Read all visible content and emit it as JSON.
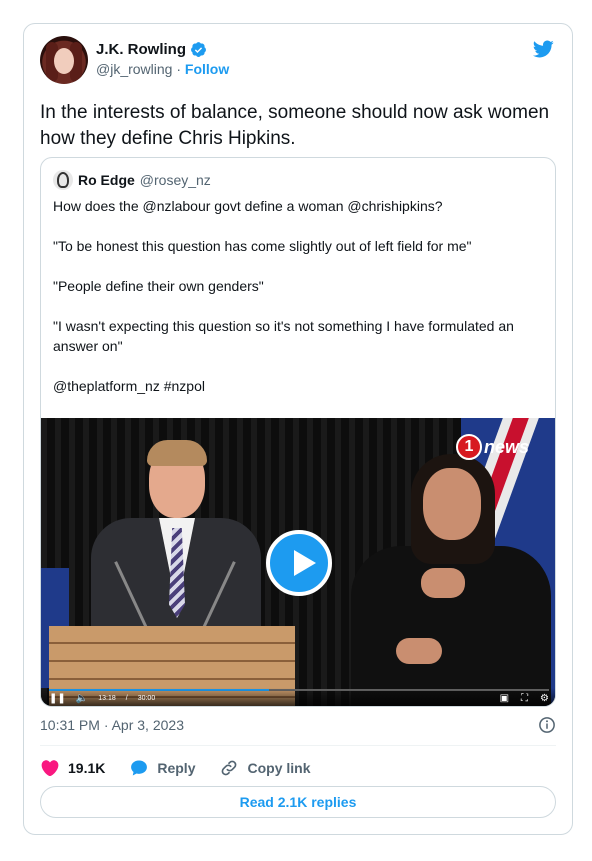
{
  "author": {
    "name": "J.K. Rowling",
    "handle": "@jk_rowling",
    "separator": "·",
    "follow_label": "Follow"
  },
  "tweet": {
    "text": "In the interests of balance, someone should now ask women how they define Chris Hipkins.",
    "timestamp": "10:31 PM · Apr 3, 2023"
  },
  "quoted": {
    "name": "Ro Edge",
    "handle": "@rosey_nz",
    "lines": [
      "How does the @nzlabour govt define a woman @chrishipkins?",
      "\"To be honest this question has come slightly out of left field for me\"",
      "\"People define their own genders\"",
      "\"I wasn't expecting this question so it's not something I have formulated an answer on\"",
      "@theplatform_nz #nzpol"
    ]
  },
  "video": {
    "brand_number": "1",
    "brand_text": "news",
    "current_time": "13:18",
    "time_sep": "/",
    "duration": "30:00",
    "progress": 0.44
  },
  "actions": {
    "likes": "19.1K",
    "reply_label": "Reply",
    "copy_label": "Copy link",
    "read_replies": "Read 2.1K replies"
  },
  "colors": {
    "accent": "#1d9bf0",
    "like": "#f91880",
    "text": "#0f1419",
    "muted": "#536471"
  }
}
